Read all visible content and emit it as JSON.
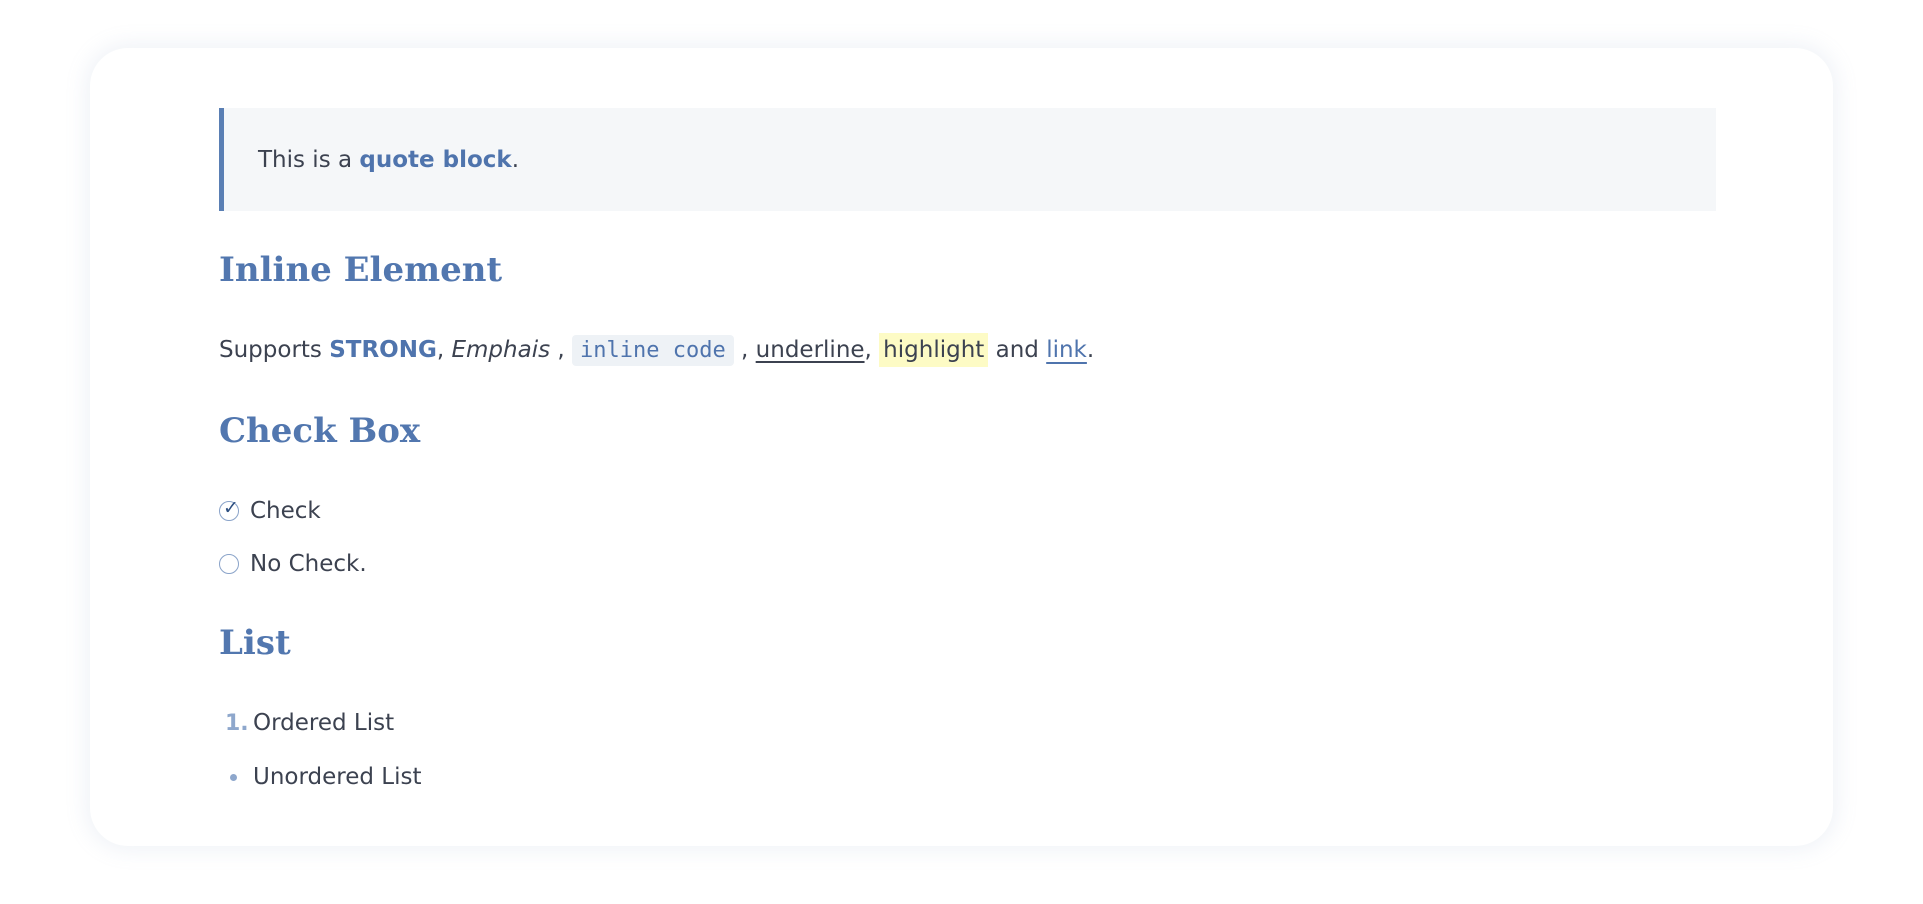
{
  "quote": {
    "text_before": "This is a ",
    "strong": "quote block",
    "text_after": "."
  },
  "inline_section": {
    "heading": "Inline Element",
    "prefix": "Supports ",
    "strong": "STRONG",
    "sep1": ", ",
    "emphasis": "Emphais",
    "sep2": " , ",
    "code": "inline code",
    "sep3": " , ",
    "underline": "underline",
    "sep4": ", ",
    "highlight": "highlight",
    "sep5": " and ",
    "link": "link",
    "suffix": "."
  },
  "checkbox_section": {
    "heading": "Check Box",
    "items": [
      {
        "label": "Check",
        "checked": true
      },
      {
        "label": "No Check.",
        "checked": false
      }
    ]
  },
  "list_section": {
    "heading": "List",
    "ordered": {
      "marker": "1.",
      "label": "Ordered List"
    },
    "unordered": {
      "label": "Unordered List"
    }
  }
}
